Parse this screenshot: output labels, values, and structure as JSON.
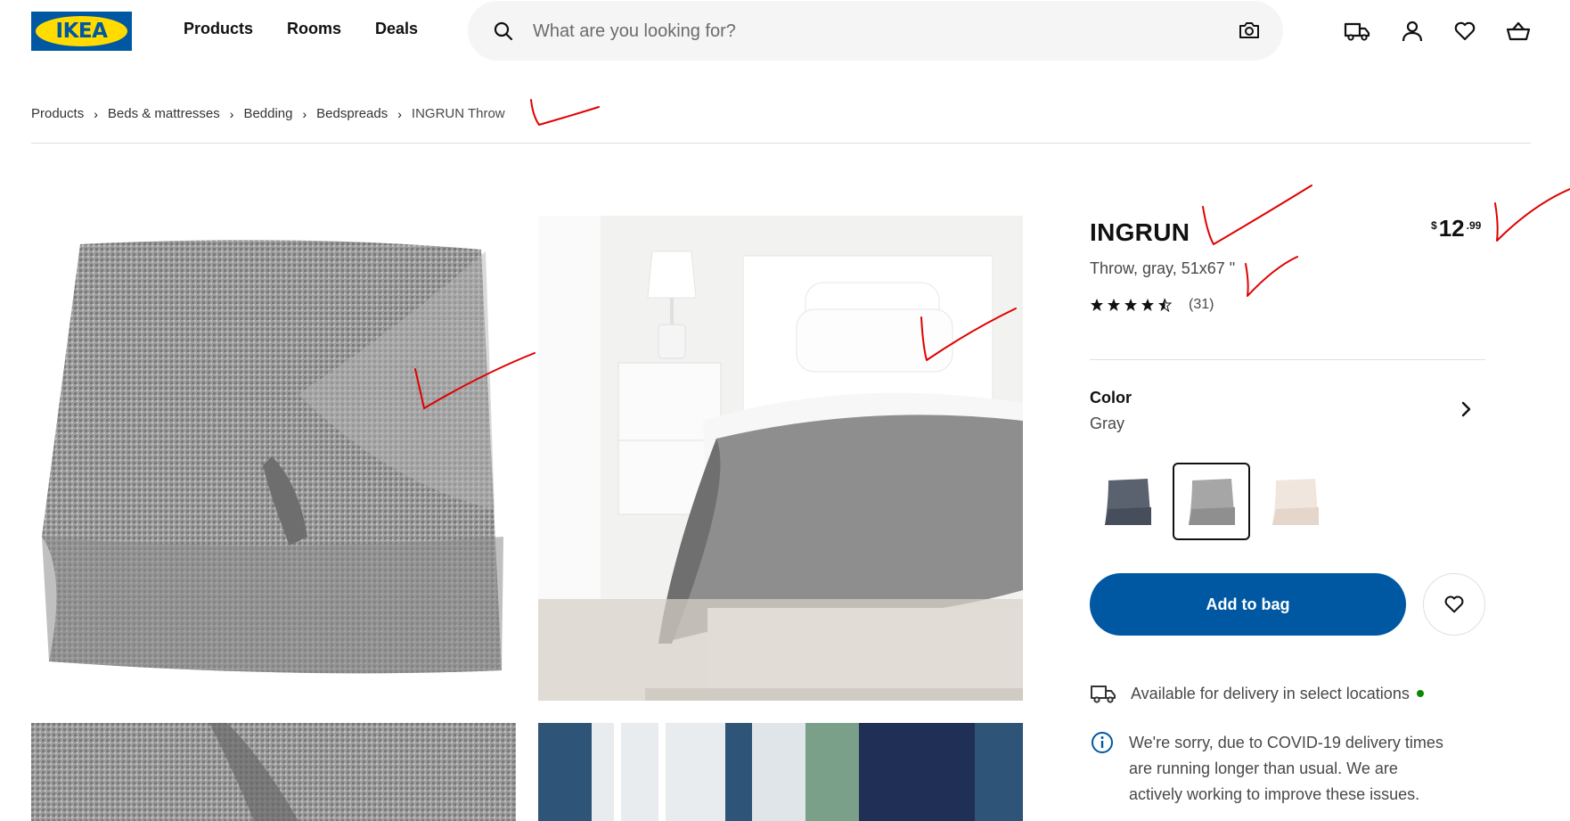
{
  "header": {
    "logo_text": "IKEA",
    "nav": [
      "Products",
      "Rooms",
      "Deals"
    ],
    "search_placeholder": "What are you looking for?",
    "icons": [
      "search-icon",
      "camera-icon",
      "truck-icon",
      "user-icon",
      "heart-icon",
      "basket-icon"
    ]
  },
  "breadcrumb": [
    "Products",
    "Beds & mattresses",
    "Bedding",
    "Bedspreads",
    "INGRUN Throw"
  ],
  "product": {
    "name": "INGRUN",
    "description": "Throw, gray, 51x67 \"",
    "price_currency": "$",
    "price_int": "12",
    "price_decimal": ".99",
    "rating": 4.5,
    "rating_count": "(31)"
  },
  "color": {
    "label": "Color",
    "value": "Gray",
    "swatches": [
      "dark gray",
      "gray",
      "off-white"
    ],
    "selected_index": 1
  },
  "actions": {
    "add_to_bag": "Add to bag"
  },
  "delivery": {
    "text": "Available for delivery in select locations",
    "status_color": "#0a8a00"
  },
  "notice": {
    "text": "We're sorry, due to COVID-19 delivery times are running longer than usual. We are actively working to improve these issues."
  },
  "colors": {
    "brand_blue": "#0058a3",
    "brand_yellow": "#ffdb00",
    "annotation_red": "#e00000"
  }
}
